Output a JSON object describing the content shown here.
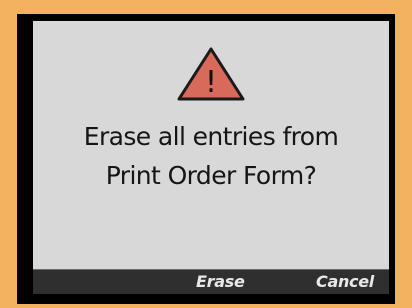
{
  "dialog": {
    "message_lines": [
      "Erase all entries from",
      "Print Order Form?"
    ],
    "icon": "warning-icon",
    "icon_glyph": "!",
    "icon_color": "#d86a5b"
  },
  "menu": {
    "erase_label": "Erase",
    "cancel_label": "Cancel"
  }
}
